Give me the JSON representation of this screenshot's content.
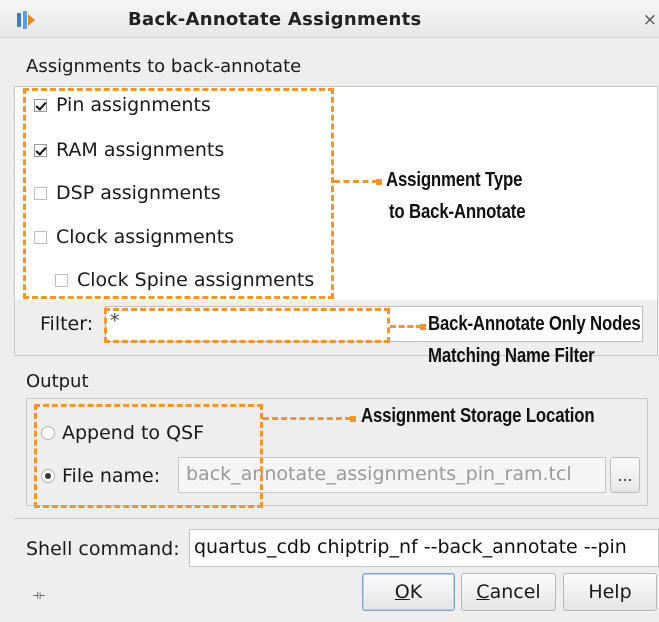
{
  "window": {
    "title": "Back-Annotate Assignments",
    "close_glyph": "×",
    "icon": "quartus-app-icon"
  },
  "assignments": {
    "group_label": "Assignments to back-annotate",
    "items": [
      {
        "label": "Pin assignments",
        "checked": true
      },
      {
        "label": "RAM assignments",
        "checked": true
      },
      {
        "label": "DSP assignments",
        "checked": false
      },
      {
        "label": "Clock assignments",
        "checked": false
      },
      {
        "label": "Clock Spine assignments",
        "checked": false
      }
    ],
    "filter_label": "Filter:",
    "filter_value": "*"
  },
  "output": {
    "group_label": "Output",
    "append_label": "Append to QSF",
    "append_selected": false,
    "file_label": "File name:",
    "file_selected": true,
    "file_value": "back_annotate_assignments_pin_ram.tcl",
    "browse_label": "..."
  },
  "shell": {
    "label": "Shell command:",
    "value": "quartus_cdb chiptrip_nf --back_annotate --pin"
  },
  "buttons": {
    "ok_underline": "O",
    "ok_rest": "K",
    "cancel_underline": "C",
    "cancel_rest": "ancel",
    "help": "Help"
  },
  "callouts": {
    "assignment_type_line1": "Assignment Type",
    "assignment_type_line2": "to Back-Annotate",
    "filter_line1": "Back-Annotate Only Nodes",
    "filter_line2": "Matching Name Filter",
    "storage": "Assignment Storage Location"
  },
  "colors": {
    "callout_accent": "#f0952f",
    "default_button_border": "#7ea7d8"
  }
}
